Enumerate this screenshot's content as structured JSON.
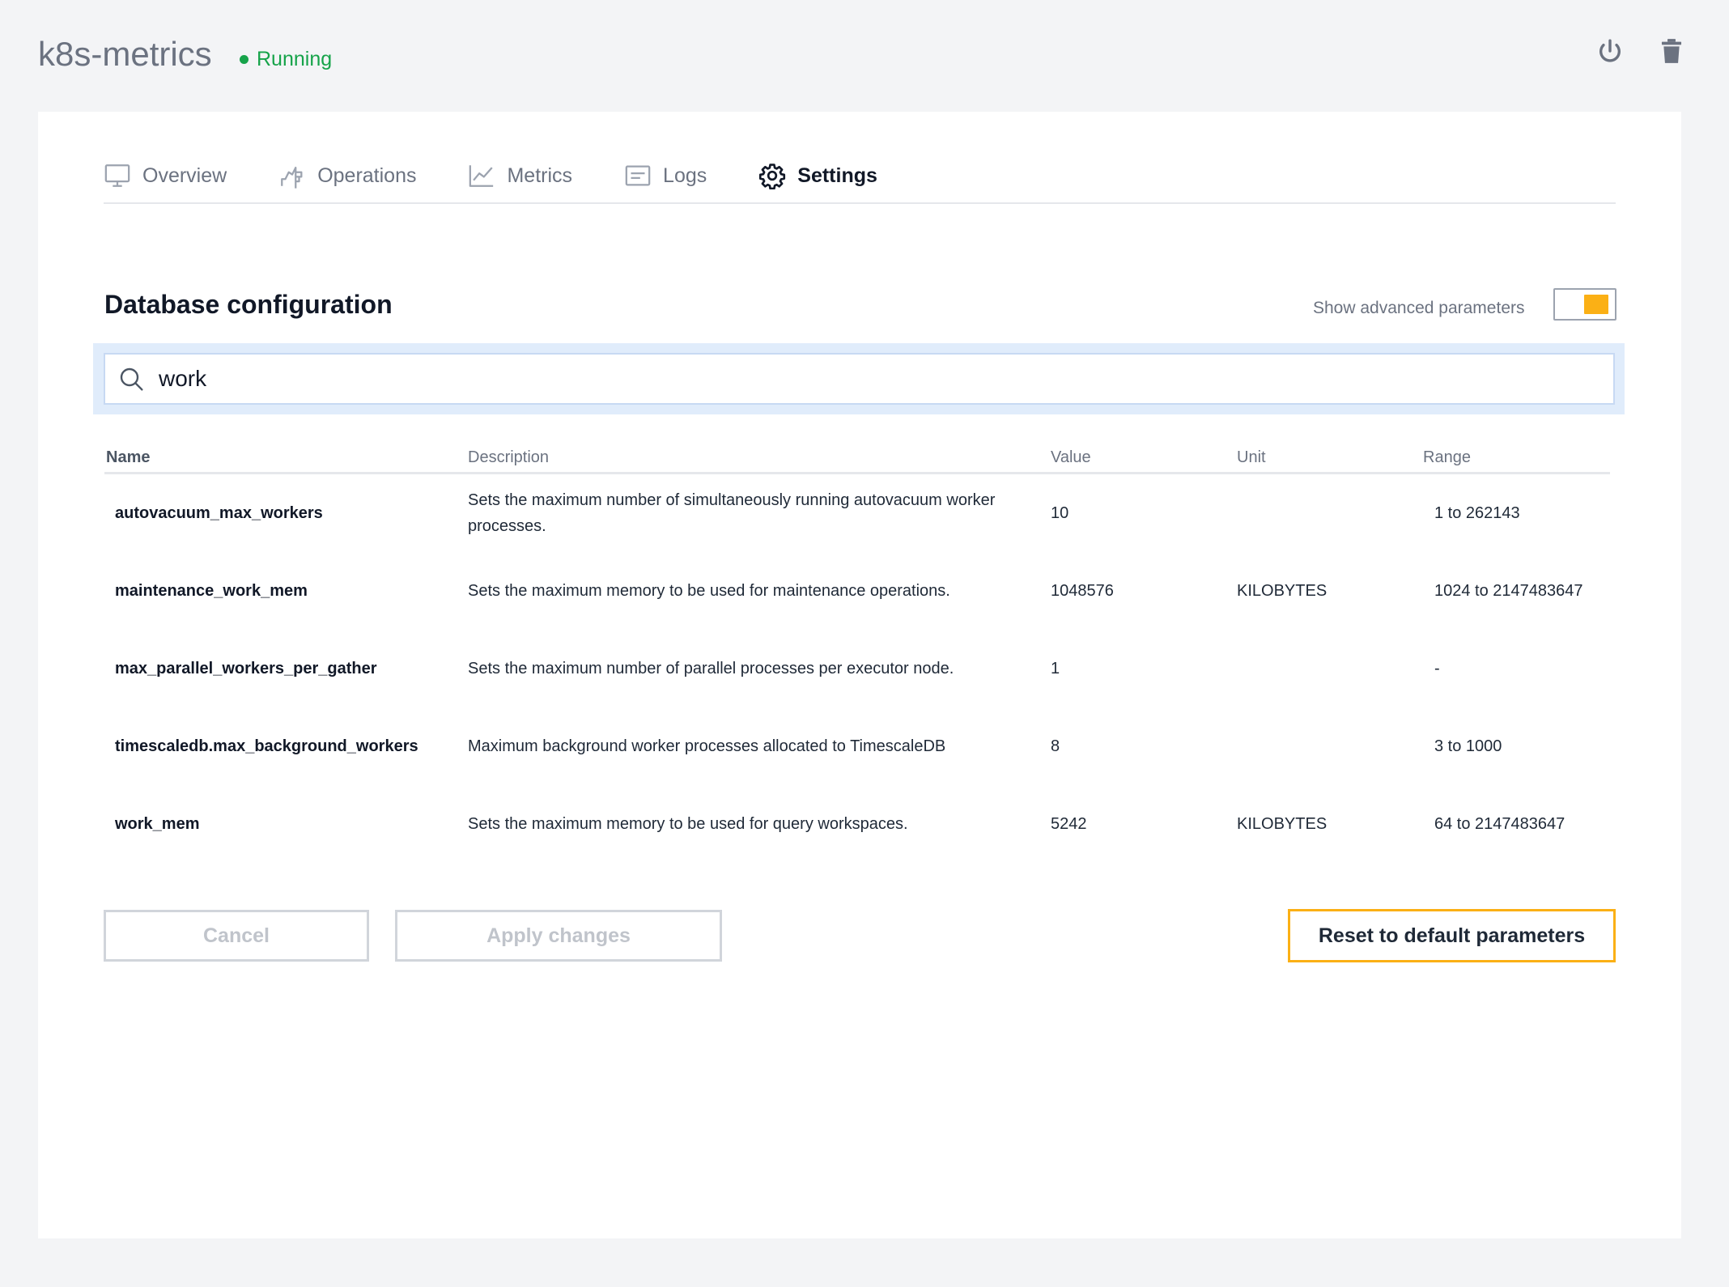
{
  "header": {
    "service_name": "k8s-metrics",
    "status": "Running",
    "status_color": "#16a34a",
    "icons": [
      "power-icon",
      "trash-icon"
    ]
  },
  "tabs": [
    {
      "label": "Overview",
      "icon": "monitor-icon",
      "active": false
    },
    {
      "label": "Operations",
      "icon": "operations-icon",
      "active": false
    },
    {
      "label": "Metrics",
      "icon": "chart-line-icon",
      "active": false
    },
    {
      "label": "Logs",
      "icon": "logs-icon",
      "active": false
    },
    {
      "label": "Settings",
      "icon": "gear-icon",
      "active": true
    }
  ],
  "section": {
    "title": "Database configuration",
    "advanced_label": "Show advanced parameters",
    "advanced_enabled": true,
    "accent_color": "#fbb015"
  },
  "search": {
    "value": "work"
  },
  "table": {
    "headers": {
      "name": "Name",
      "description": "Description",
      "value": "Value",
      "unit": "Unit",
      "range": "Range"
    },
    "rows": [
      {
        "name": "autovacuum_max_workers",
        "description": "Sets the maximum number of simultaneously running autovacuum worker processes.",
        "value": "10",
        "unit": "",
        "range": "1 to 262143"
      },
      {
        "name": "maintenance_work_mem",
        "description": "Sets the maximum memory to be used for maintenance operations.",
        "value": "1048576",
        "unit": "KILOBYTES",
        "range": "1024 to 2147483647"
      },
      {
        "name": "max_parallel_workers_per_gather",
        "description": "Sets the maximum number of parallel processes per executor node.",
        "value": "1",
        "unit": "",
        "range": "-"
      },
      {
        "name": "timescaledb.max_background_workers",
        "description": "Maximum background worker processes allocated to TimescaleDB",
        "value": "8",
        "unit": "",
        "range": "3 to 1000"
      },
      {
        "name": "work_mem",
        "description": "Sets the maximum memory to be used for query workspaces.",
        "value": "5242",
        "unit": "KILOBYTES",
        "range": "64 to 2147483647"
      }
    ]
  },
  "buttons": {
    "cancel": "Cancel",
    "apply": "Apply changes",
    "reset": "Reset to default parameters"
  }
}
